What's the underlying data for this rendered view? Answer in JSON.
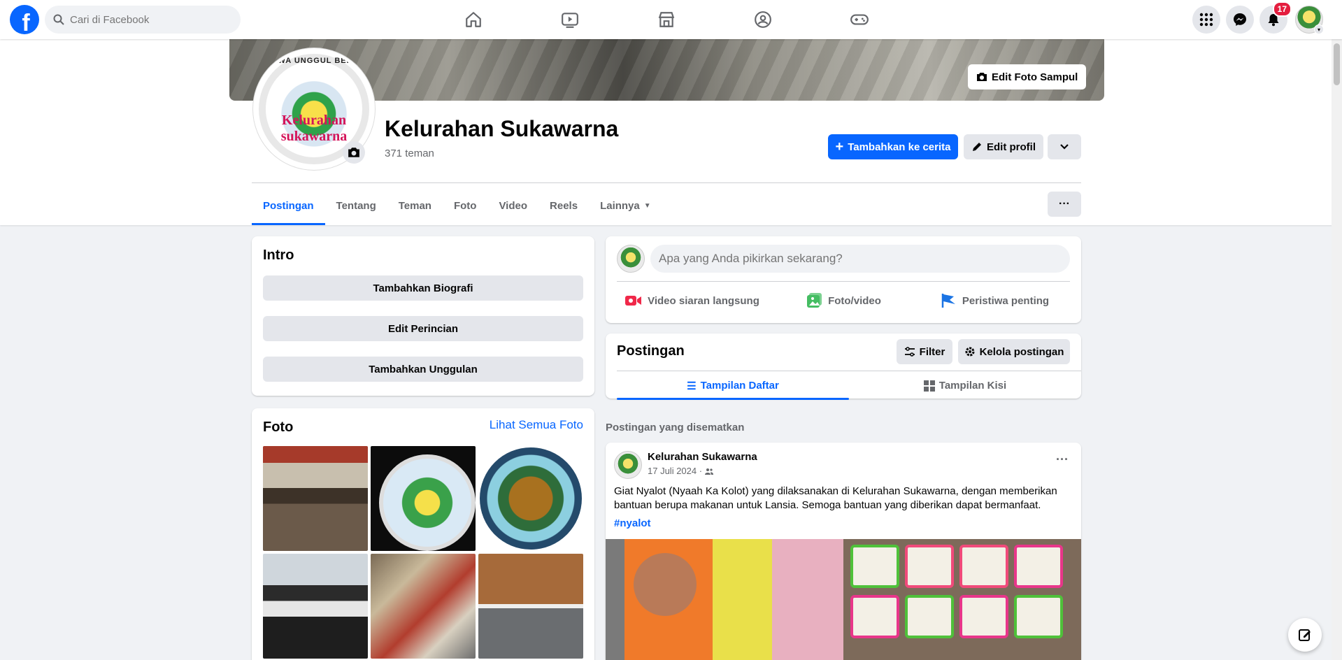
{
  "topnav": {
    "logo_letter": "f",
    "search_placeholder": "Cari di Facebook",
    "center_icons": [
      "home-icon",
      "video-icon",
      "marketplace-icon",
      "groups-icon",
      "gaming-icon"
    ],
    "right_icons": [
      "menu-grid-icon",
      "messenger-icon",
      "bell-icon"
    ],
    "notification_count": "17",
    "accent": "#0866ff"
  },
  "profile": {
    "name": "Kelurahan Sukawarna",
    "friends": "371 teman",
    "edit_cover_label": "Edit Foto Sampul",
    "add_story_label": "Tambahkan ke cerita",
    "edit_profile_label": "Edit profil",
    "picture_ring_text": "TAQWA UNGGUL BERSIH",
    "picture_logo_text": "Kelurahan sukawarna"
  },
  "tabs": [
    {
      "label": "Postingan",
      "active": true
    },
    {
      "label": "Tentang"
    },
    {
      "label": "Teman"
    },
    {
      "label": "Foto"
    },
    {
      "label": "Video"
    },
    {
      "label": "Reels"
    },
    {
      "label": "Lainnya"
    }
  ],
  "intro": {
    "title": "Intro",
    "buttons": [
      "Tambahkan Biografi",
      "Edit Perincian",
      "Tambahkan Unggulan"
    ]
  },
  "photos": {
    "title": "Foto",
    "see_all": "Lihat Semua Foto"
  },
  "composer": {
    "placeholder": "Apa yang Anda pikirkan sekarang?",
    "actions": [
      "Video siaran langsung",
      "Foto/video",
      "Peristiwa penting"
    ]
  },
  "posts_panel": {
    "title": "Postingan",
    "filter_label": "Filter",
    "manage_label": "Kelola postingan",
    "view_tabs": [
      "Tampilan Daftar",
      "Tampilan Kisi"
    ]
  },
  "pinned_label": "Postingan yang disematkan",
  "post": {
    "author": "Kelurahan Sukawarna",
    "date": "17 Juli 2024 ·",
    "text": "Giat Nyalot (Nyaah Ka Kolot) yang dilaksanakan di Kelurahan Sukawarna, dengan memberikan bantuan berupa makanan untuk Lansia. Semoga bantuan yang diberikan dapat bermanfaat.",
    "hashtag": "#nyalot"
  }
}
